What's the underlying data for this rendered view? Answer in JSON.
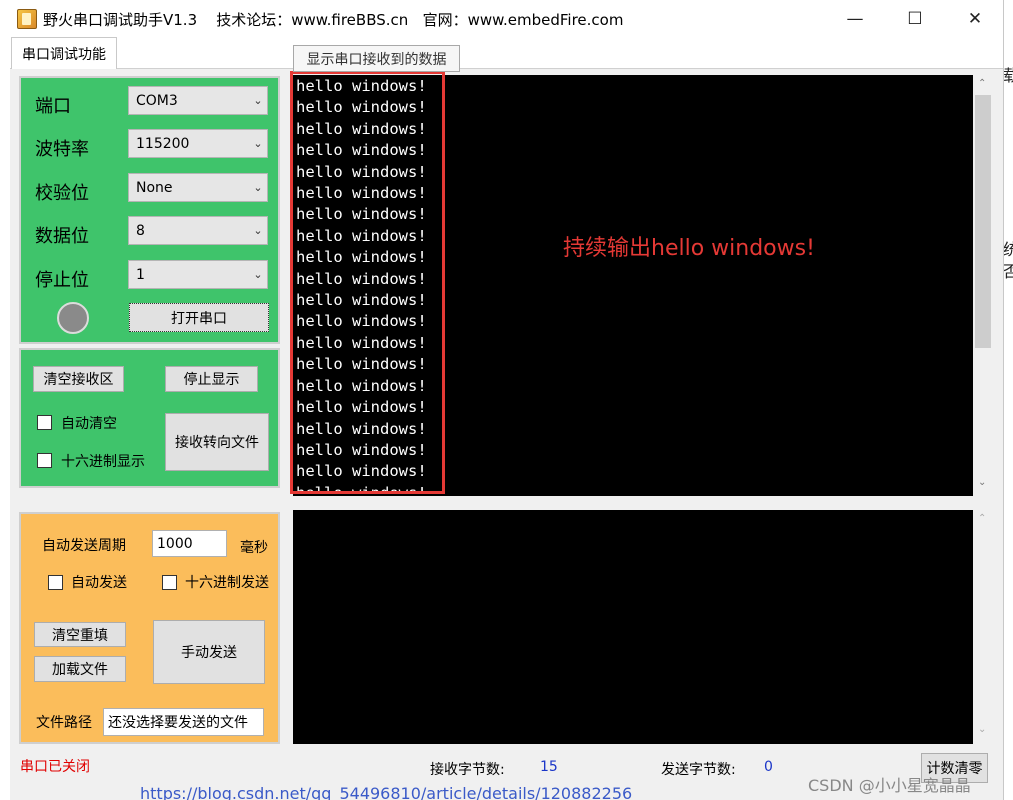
{
  "window": {
    "title": "野火串口调试助手V1.3    技术论坛：www.fireBBS.cn   官网：www.embedFire.com",
    "minimize": "—",
    "maximize": "☐",
    "close": "✕"
  },
  "tab": {
    "label": "串口调试功能"
  },
  "tooltip": {
    "text": "显示串口接收到的数据"
  },
  "serial": {
    "port_label": "端口",
    "port_value": "COM3",
    "baud_label": "波特率",
    "baud_value": "115200",
    "parity_label": "校验位",
    "parity_value": "None",
    "databits_label": "数据位",
    "databits_value": "8",
    "stopbits_label": "停止位",
    "stopbits_value": "1",
    "open_button": "打开串口"
  },
  "receive": {
    "clear_button": "清空接收区",
    "stop_button": "停止显示",
    "auto_clear_label": "自动清空",
    "hex_display_label": "十六进制显示",
    "redirect_button": "接收转向文件",
    "lines": [
      "hello windows!",
      "hello windows!",
      "hello windows!",
      "hello windows!",
      "hello windows!",
      "hello windows!",
      "hello windows!",
      "hello windows!",
      "hello windows!",
      "hello windows!",
      "hello windows!",
      "hello windows!",
      "hello windows!",
      "hello windows!",
      "hello windows!",
      "hello windows!",
      "hello windows!",
      "hello windows!",
      "hello windows!",
      "hello windows!"
    ],
    "annotation": "持续输出hello windows!"
  },
  "send": {
    "period_label": "自动发送周期",
    "period_value": "1000",
    "period_unit": "毫秒",
    "auto_send_label": "自动发送",
    "hex_send_label": "十六进制发送",
    "clear_button": "清空重填",
    "load_button": "加载文件",
    "manual_button": "手动发送",
    "path_label": "文件路径",
    "path_value": "还没选择要发送的文件"
  },
  "status": {
    "port_state": "串口已关闭",
    "rx_label": "接收字节数:",
    "rx_value": "15",
    "tx_label": "发送字节数:",
    "tx_value": "0",
    "reset_button": "计数清零"
  },
  "background": {
    "url_text": "https://blog.csdn.net/qq_54496810/article/details/120882256",
    "side_1": "载",
    "side_2": "统",
    "side_3": "否"
  },
  "watermark": "CSDN @小小星宽晶晶",
  "colors": {
    "green_panel": "#3fc46b",
    "orange_panel": "#fbbd5b",
    "terminal": "#000000",
    "annotation": "#e53935",
    "status_red": "#e00000",
    "counter_blue": "#1a35c8"
  }
}
